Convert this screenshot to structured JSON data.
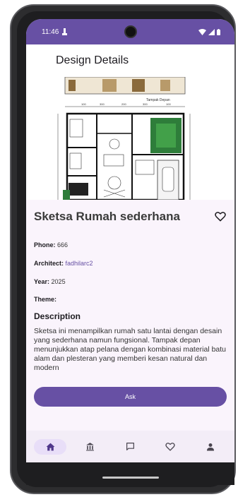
{
  "status_bar": {
    "time": "11:46"
  },
  "app_bar": {
    "title": "Design Details"
  },
  "hero": {
    "label_top": "Tampak Depan",
    "dims": [
      "100",
      "300",
      "200",
      "300",
      "100"
    ]
  },
  "design": {
    "title": "Sketsa Rumah sederhana",
    "phone_label": "Phone:",
    "phone_value": "666",
    "architect_label": "Architect:",
    "architect_value": "fadhilarc2",
    "year_label": "Year:",
    "year_value": "2025",
    "theme_label": "Theme:",
    "theme_value": ""
  },
  "description": {
    "heading": "Description",
    "text": "Sketsa ini menampilkan rumah satu lantai dengan desain yang sederhana namun fungsional. Tampak depan menunjukkan atap pelana dengan kombinasi material batu alam dan plesteran yang memberi kesan natural dan modern"
  },
  "actions": {
    "ask_label": "Ask"
  },
  "bottom_nav": {
    "items": [
      {
        "icon": "home-icon",
        "active": true
      },
      {
        "icon": "building-icon",
        "active": false
      },
      {
        "icon": "chat-icon",
        "active": false
      },
      {
        "icon": "heart-icon",
        "active": false
      },
      {
        "icon": "person-icon",
        "active": false
      }
    ]
  },
  "colors": {
    "primary": "#6750a4",
    "surface": "#faf4fc",
    "nav_active": "#e8def8"
  }
}
